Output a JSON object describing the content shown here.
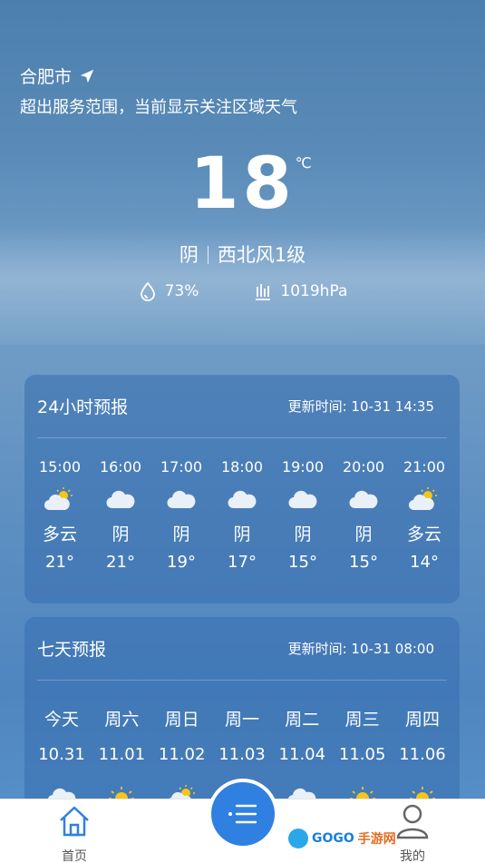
{
  "location": {
    "city": "合肥市",
    "notice": "超出服务范围，当前显示关注区域天气"
  },
  "current": {
    "temperature": "18",
    "unit": "℃",
    "condition": "阴",
    "wind": "西北风1级",
    "humidity": "73%",
    "pressure": "1019hPa"
  },
  "hourly": {
    "title": "24小时预报",
    "updated": "更新时间: 10-31 14:35",
    "items": [
      {
        "time": "15:00",
        "icon": "partly-cloudy-icon",
        "desc": "多云",
        "temp": "21°"
      },
      {
        "time": "16:00",
        "icon": "cloud-icon",
        "desc": "阴",
        "temp": "21°"
      },
      {
        "time": "17:00",
        "icon": "cloud-icon",
        "desc": "阴",
        "temp": "19°"
      },
      {
        "time": "18:00",
        "icon": "cloud-icon",
        "desc": "阴",
        "temp": "17°"
      },
      {
        "time": "19:00",
        "icon": "cloud-icon",
        "desc": "阴",
        "temp": "15°"
      },
      {
        "time": "20:00",
        "icon": "cloud-icon",
        "desc": "阴",
        "temp": "15°"
      },
      {
        "time": "21:00",
        "icon": "partly-cloudy-icon",
        "desc": "多云",
        "temp": "14°"
      }
    ]
  },
  "daily": {
    "title": "七天预报",
    "updated": "更新时间: 10-31 08:00",
    "items": [
      {
        "day": "今天",
        "date": "10.31",
        "icon": "cloud-icon"
      },
      {
        "day": "周六",
        "date": "11.01",
        "icon": "sun-icon"
      },
      {
        "day": "周日",
        "date": "11.02",
        "icon": "partly-cloudy-icon"
      },
      {
        "day": "周一",
        "date": "11.03",
        "icon": "cloud-icon"
      },
      {
        "day": "周二",
        "date": "11.04",
        "icon": "cloud-icon"
      },
      {
        "day": "周三",
        "date": "11.05",
        "icon": "sun-icon"
      },
      {
        "day": "周四",
        "date": "11.06",
        "icon": "sun-icon"
      }
    ]
  },
  "tabbar": {
    "home_label": "首页",
    "mine_label": "我的",
    "accent": "#2f80e0"
  },
  "watermark": {
    "brand": "GOGO",
    "cn": "手游网"
  }
}
